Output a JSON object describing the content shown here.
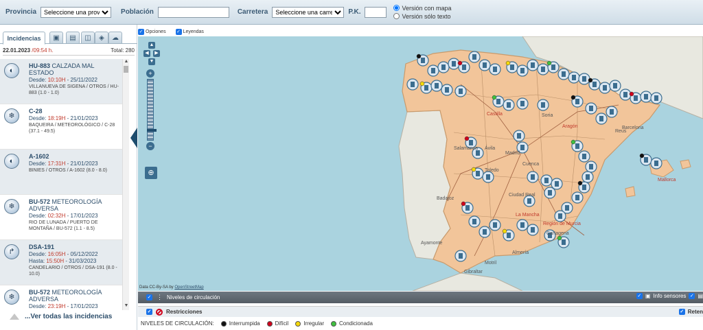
{
  "filters": {
    "provincia_label": "Provincia",
    "provincia_value": "Seleccione una provincia",
    "poblacion_label": "Población",
    "carretera_label": "Carretera",
    "carretera_value": "Seleccione una carretera",
    "pk_label": "P.K.",
    "radio_map": "Versión con mapa",
    "radio_text": "Versión sólo texto"
  },
  "left": {
    "tab_main": "Incidencias",
    "tab_icons": [
      "camera-icon",
      "panel-icon",
      "book-icon",
      "sensor-icon",
      "weather-icon"
    ],
    "date": "22.01.2023",
    "time": "/09:54 h.",
    "total": "Total: 280",
    "see_all": "...Ver todas las incidencias",
    "incidents": [
      {
        "road": "HU-883",
        "type": "CALZADA MAL ESTADO",
        "since_label": "Desde:",
        "since_time": "10:10H",
        "since_date": " - 25/11/2022",
        "until_label": "",
        "until_time": "",
        "until_date": "",
        "desc": "VILLANUEVA DE SIGENA / OTROS / HU-883 (1.0 - 1.0)",
        "icon": "road-damage-icon"
      },
      {
        "road": "C-28",
        "type": "",
        "since_label": "Desde:",
        "since_time": "18:19H",
        "since_date": " - 21/01/2023",
        "until_label": "",
        "until_time": "",
        "until_date": "",
        "desc": "BAQUEIRA / METEOROLÓGICO / C-28 (37.1 - 49.5)",
        "icon": "weather-icon"
      },
      {
        "road": "A-1602",
        "type": "",
        "since_label": "Desde:",
        "since_time": "17:31H",
        "since_date": " - 21/01/2023",
        "until_label": "",
        "until_time": "",
        "until_date": "",
        "desc": "BINIES / OTROS / A-1602 (8.0 - 8.0)",
        "icon": "road-damage-icon"
      },
      {
        "road": "BU-572",
        "type": "METEOROLOGÍA ADVERSA",
        "since_label": "Desde:",
        "since_time": "02:32H",
        "since_date": " - 17/01/2023",
        "until_label": "",
        "until_time": "",
        "until_date": "",
        "desc": "RIO DE LUNADA / PUERTO DE MONTAÑA / BU-572 (1.1 - 8.5)",
        "icon": "snow-icon"
      },
      {
        "road": "DSA-191",
        "type": "",
        "since_label": "Desde:",
        "since_time": "16:05H",
        "since_date": " - 05/12/2022",
        "until_label": "Hasta:",
        "until_time": "15:50H",
        "until_date": " - 31/03/2023",
        "desc": "CANDELARIO / OTROS / DSA-191 (8.0 - 10.0)",
        "icon": "detour-icon"
      },
      {
        "road": "BU-572",
        "type": "METEOROLOGÍA ADVERSA",
        "since_label": "Desde:",
        "since_time": "23:19H",
        "since_date": " - 17/01/2023",
        "until_label": "",
        "until_time": "",
        "until_date": "",
        "desc": "",
        "icon": "snow-icon"
      }
    ]
  },
  "map": {
    "opt_options": "Opciones",
    "opt_legends": "Leyendas",
    "attribution": "Data CC-By-SA by",
    "attribution_link": "OpenStreetMap",
    "cities": [
      {
        "name": "Salamanca",
        "red": false
      },
      {
        "name": "Ávila",
        "red": false
      },
      {
        "name": "Toledo",
        "red": false
      },
      {
        "name": "Cuenca",
        "red": false
      },
      {
        "name": "Ciudad Real",
        "red": false
      },
      {
        "name": "Badajoz",
        "red": false
      },
      {
        "name": "Barcelona",
        "red": false
      },
      {
        "name": "Reus",
        "red": false
      },
      {
        "name": "Mallorca",
        "red": true
      },
      {
        "name": "Ayamonte",
        "red": false
      },
      {
        "name": "Gibraltar",
        "red": false
      },
      {
        "name": "Motril",
        "red": false
      },
      {
        "name": "Almería",
        "red": false
      },
      {
        "name": "Cartagena",
        "red": false
      },
      {
        "name": "Región de Murcia",
        "red": true
      },
      {
        "name": "La Mancha",
        "red": true
      },
      {
        "name": "Castilla",
        "red": true
      },
      {
        "name": "Aragón",
        "red": true
      },
      {
        "name": "Soria",
        "red": false
      },
      {
        "name": "Madrid",
        "red": false
      }
    ]
  },
  "layers": {
    "niveles": "Niveles de circulación",
    "info_sensores": "Info sensores",
    "restricciones": "Restricciones",
    "retenciones": "Reten"
  },
  "legend": {
    "title": "NIVELES DE CIRCULACIÓN:",
    "items": [
      {
        "label": "Interrumpida",
        "color": "#111111"
      },
      {
        "label": "Difícil",
        "color": "#d0021b"
      },
      {
        "label": "Irregular",
        "color": "#f5d90a"
      },
      {
        "label": "Condicionada",
        "color": "#3fbf3f"
      }
    ]
  },
  "colors": {
    "land_spain": "#f2c59a",
    "sea": "#aad3df",
    "land_other": "#e8e8e0",
    "accent": "#3a5a74"
  }
}
